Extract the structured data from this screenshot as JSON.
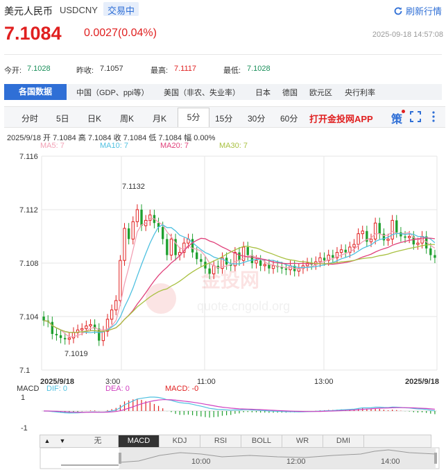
{
  "header": {
    "name": "美元人民币",
    "code": "USDCNY",
    "status": "交易中",
    "refresh": "刷新行情"
  },
  "quote": {
    "price": "7.1084",
    "change": "0.0027(0.04%)",
    "datetime": "2025-09-18 14:57:08"
  },
  "stats": {
    "open_label": "今开:",
    "open": "7.1028",
    "prev_label": "昨收:",
    "prev": "7.1057",
    "high_label": "最高:",
    "high": "7.1117",
    "low_label": "最低:",
    "low": "7.1028"
  },
  "nav": {
    "active": "各国数据",
    "items": [
      "中国（GDP、ppi等）",
      "美国（非农、失业率）",
      "日本",
      "德国",
      "欧元区",
      "央行利率"
    ]
  },
  "periods": {
    "items": [
      "分时",
      "5日",
      "日K",
      "周K",
      "月K",
      "5分",
      "15分",
      "30分",
      "60分"
    ],
    "active": "5分",
    "app": "打开金投网APP",
    "strategy": "策"
  },
  "ohlc": {
    "date": "2025/9/18",
    "open_label": "开",
    "open": "7.1084",
    "high_label": "高",
    "high": "7.1084",
    "close_label": "收",
    "close": "7.1084",
    "low_label": "低",
    "low": "7.1084",
    "amp_label": "幅",
    "amp": "0.00%"
  },
  "ma": {
    "ma5": "MA5: 7",
    "ma10": "MA10: 7",
    "ma20": "MA20: 7",
    "ma30": "MA30: 7"
  },
  "colors": {
    "up": "#e02020",
    "down": "#1fa02f",
    "ma5": "#f2a0b4",
    "ma10": "#4ec0e0",
    "ma20": "#e0407a",
    "ma30": "#a8c040",
    "accent": "#2f6fd6"
  },
  "chart_data": {
    "type": "candlestick",
    "y_ticks": [
      "7.116",
      "7.112",
      "7.108",
      "7.104",
      "7.1"
    ],
    "ylim": [
      7.1,
      7.116
    ],
    "x_labels": [
      "2025/9/18",
      "3:00",
      "11:00",
      "13:00",
      "2025/9/18"
    ],
    "annotations": {
      "max": "7.1132",
      "min": "7.1019"
    },
    "watermark": "quote.cngold.org",
    "close": [
      7.1037,
      7.1036,
      7.1027,
      7.1026,
      7.1024,
      7.1023,
      7.1024,
      7.1028,
      7.103,
      7.1031,
      7.1033,
      7.1034,
      7.1031,
      7.1022,
      7.1029,
      7.1038,
      7.1045,
      7.1052,
      7.1082,
      7.1106,
      7.1098,
      7.1111,
      7.112,
      7.1108,
      7.1112,
      7.1116,
      7.111,
      7.1107,
      7.1098,
      7.1086,
      7.1098,
      7.1086,
      7.1088,
      7.1095,
      7.1098,
      7.1088,
      7.1083,
      7.1081,
      7.1076,
      7.1072,
      7.1078,
      7.1076,
      7.1084,
      7.1079,
      7.1078,
      7.1088,
      7.1082,
      7.1092,
      7.1086,
      7.108,
      7.1082,
      7.1078,
      7.1079,
      7.1076,
      7.1078,
      7.1077,
      7.1076,
      7.1075,
      7.1078,
      7.1074,
      7.1076,
      7.1078,
      7.108,
      7.1079,
      7.1081,
      7.1084,
      7.1082,
      7.1086,
      7.1084,
      7.1088,
      7.109,
      7.1088,
      7.1092,
      7.1094,
      7.1102,
      7.1104,
      7.1096,
      7.1098,
      7.111,
      7.1102,
      7.1097,
      7.1098,
      7.1112,
      7.1103,
      7.11,
      7.1099,
      7.11,
      7.1094,
      7.1095,
      7.11,
      7.1091,
      7.1086,
      7.1084
    ],
    "series": [
      {
        "name": "MA5"
      },
      {
        "name": "MA10"
      },
      {
        "name": "MA20"
      },
      {
        "name": "MA30"
      }
    ],
    "macd_ticks": [
      "1",
      "-1"
    ]
  },
  "macd": {
    "title": "MACD",
    "dif": "DIF: 0",
    "dea": "DEA: 0",
    "macd": "MACD: -0"
  },
  "indicators": {
    "items": [
      "无",
      "MACD",
      "KDJ",
      "RSI",
      "BOLL",
      "WR",
      "DMI"
    ],
    "active": "MACD"
  },
  "navigator": {
    "times": [
      "10:00",
      "12:00",
      "14:00"
    ]
  }
}
